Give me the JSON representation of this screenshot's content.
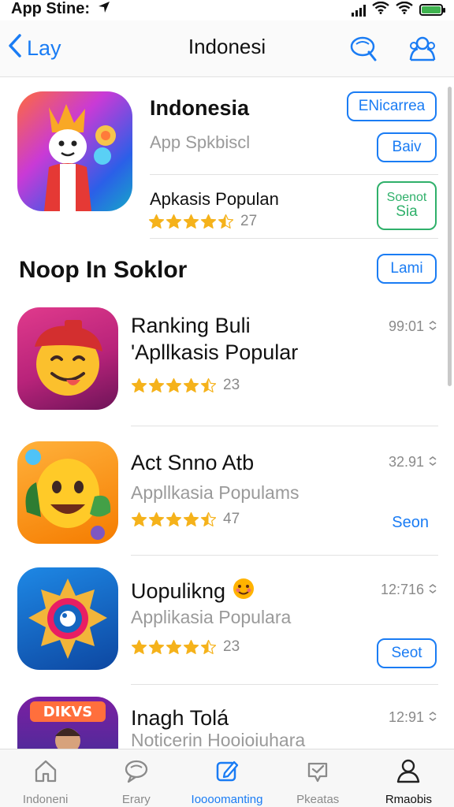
{
  "status_bar": {
    "app_label": "App Stine:",
    "location_icon": "location-arrow-icon",
    "battery_color": "#3fb34f"
  },
  "nav": {
    "back_label": "Lay",
    "title": "Indonesi"
  },
  "featured": {
    "title": "Indonesia",
    "subtitle": "App Spkbiscl",
    "category": "Apkasis Populan",
    "rating_count": "27",
    "rating_stars": 4.5,
    "btn_primary": "ENicarrea",
    "btn_secondary": "Baiv",
    "btn_tertiary_line1": "Soenot",
    "btn_tertiary_line2": "Sia"
  },
  "section": {
    "title": "Noop In Soklor",
    "action": "Lami"
  },
  "apps": [
    {
      "title": "Ranking Buli",
      "title2": "'Apllkasis Popular",
      "subtitle": "",
      "rating_stars": 4.5,
      "rating_count": "23",
      "meta": "99:01",
      "action": ""
    },
    {
      "title": "Act Snno Atb",
      "title2": "",
      "subtitle": "Appllkasia Populams",
      "rating_stars": 4.5,
      "rating_count": "47",
      "meta": "32.91",
      "action": "Seon"
    },
    {
      "title": "Uopulikng",
      "title2": "",
      "subtitle": "Applikasia Populara",
      "rating_stars": 4.5,
      "rating_count": "23",
      "meta": "12:716",
      "action": "Seot"
    },
    {
      "title": "Inagh Tolá",
      "title2": "",
      "subtitle": "Noticerin Hooioiuhara",
      "rating_stars": 0,
      "rating_count": "",
      "meta": "12:91",
      "action": "",
      "icon_text": "DIKVS"
    }
  ],
  "tabs": [
    {
      "label": "Indoneni",
      "icon": "home-icon"
    },
    {
      "label": "Erary",
      "icon": "chat-icon"
    },
    {
      "label": "Ioooomanting",
      "icon": "edit-square-icon"
    },
    {
      "label": "Pkeatas",
      "icon": "badge-check-icon"
    },
    {
      "label": "Rmaobis",
      "icon": "person-icon"
    }
  ],
  "colors": {
    "accent": "#1a7cf4",
    "star": "#f5b21b",
    "green": "#2fb06a"
  }
}
